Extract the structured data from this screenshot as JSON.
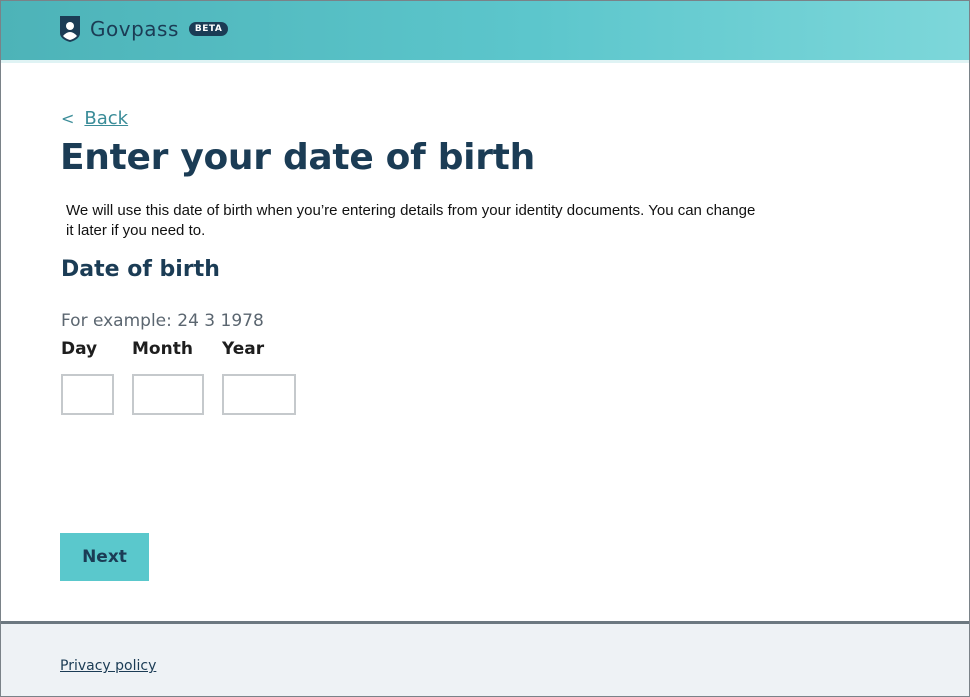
{
  "header": {
    "brand": "Govpass",
    "badge": "BETA",
    "logo_icon": "shield-person-icon",
    "gradient": [
      "#4db3b8",
      "#5cc6cc",
      "#7dd7da"
    ]
  },
  "nav": {
    "back_chevron": "<",
    "back_label": "Back"
  },
  "main": {
    "title": "Enter your date of birth",
    "intro": "We will use this date of birth when you’re entering details from your identity documents. You can change it later if you need to.",
    "section_title": "Date of birth",
    "hint": "For example: 24 3 1978",
    "fields": {
      "day_label": "Day",
      "month_label": "Month",
      "year_label": "Year",
      "day_value": "",
      "month_value": "",
      "year_value": ""
    },
    "next_label": "Next"
  },
  "footer": {
    "privacy_label": "Privacy policy"
  },
  "colors": {
    "primary_text": "#1b3c55",
    "accent": "#5ac8cc",
    "link": "#3a8c98",
    "footer_bg": "#eef2f5"
  }
}
